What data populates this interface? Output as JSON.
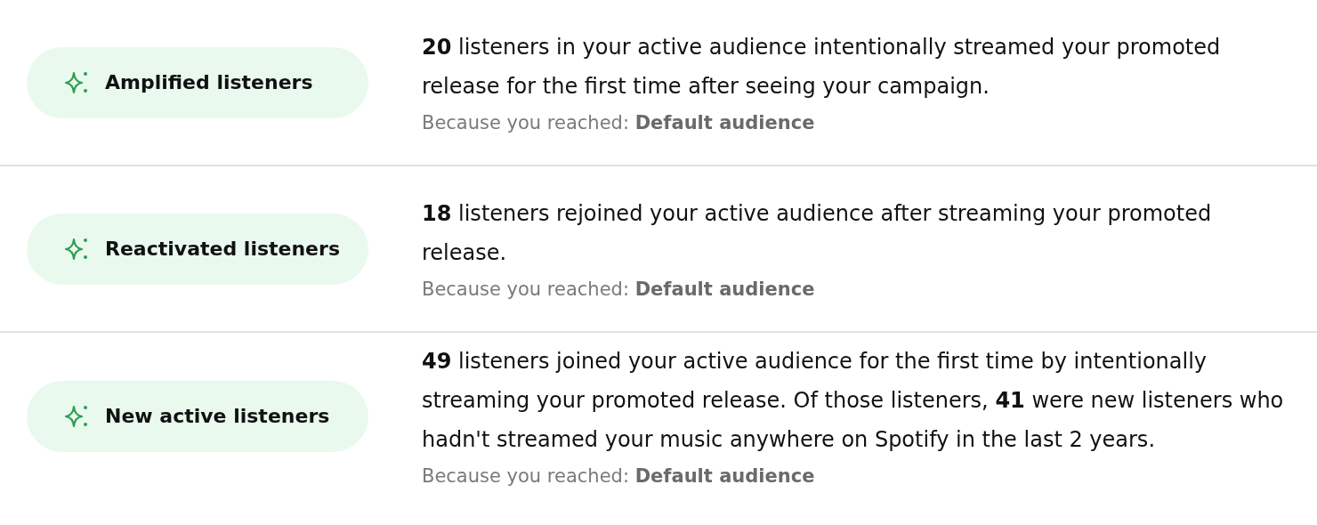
{
  "rows": [
    {
      "badge": "Amplified listeners",
      "description": "**20** listeners in your active audience intentionally streamed your promoted release for the first time after seeing your campaign.",
      "reason": "Because you reached: **Default audience**"
    },
    {
      "badge": "Reactivated listeners",
      "description": "**18** listeners rejoined your active audience after streaming your promoted release.",
      "reason": "Because you reached: **Default audience**"
    },
    {
      "badge": "New active listeners",
      "description": "**49** listeners joined your active audience for the first time by intentionally streaming your promoted release. Of those listeners, **41** were new listeners who hadn't streamed your music anywhere on Spotify in the last 2 years.",
      "reason": "Because you reached: **Default audience**"
    }
  ]
}
